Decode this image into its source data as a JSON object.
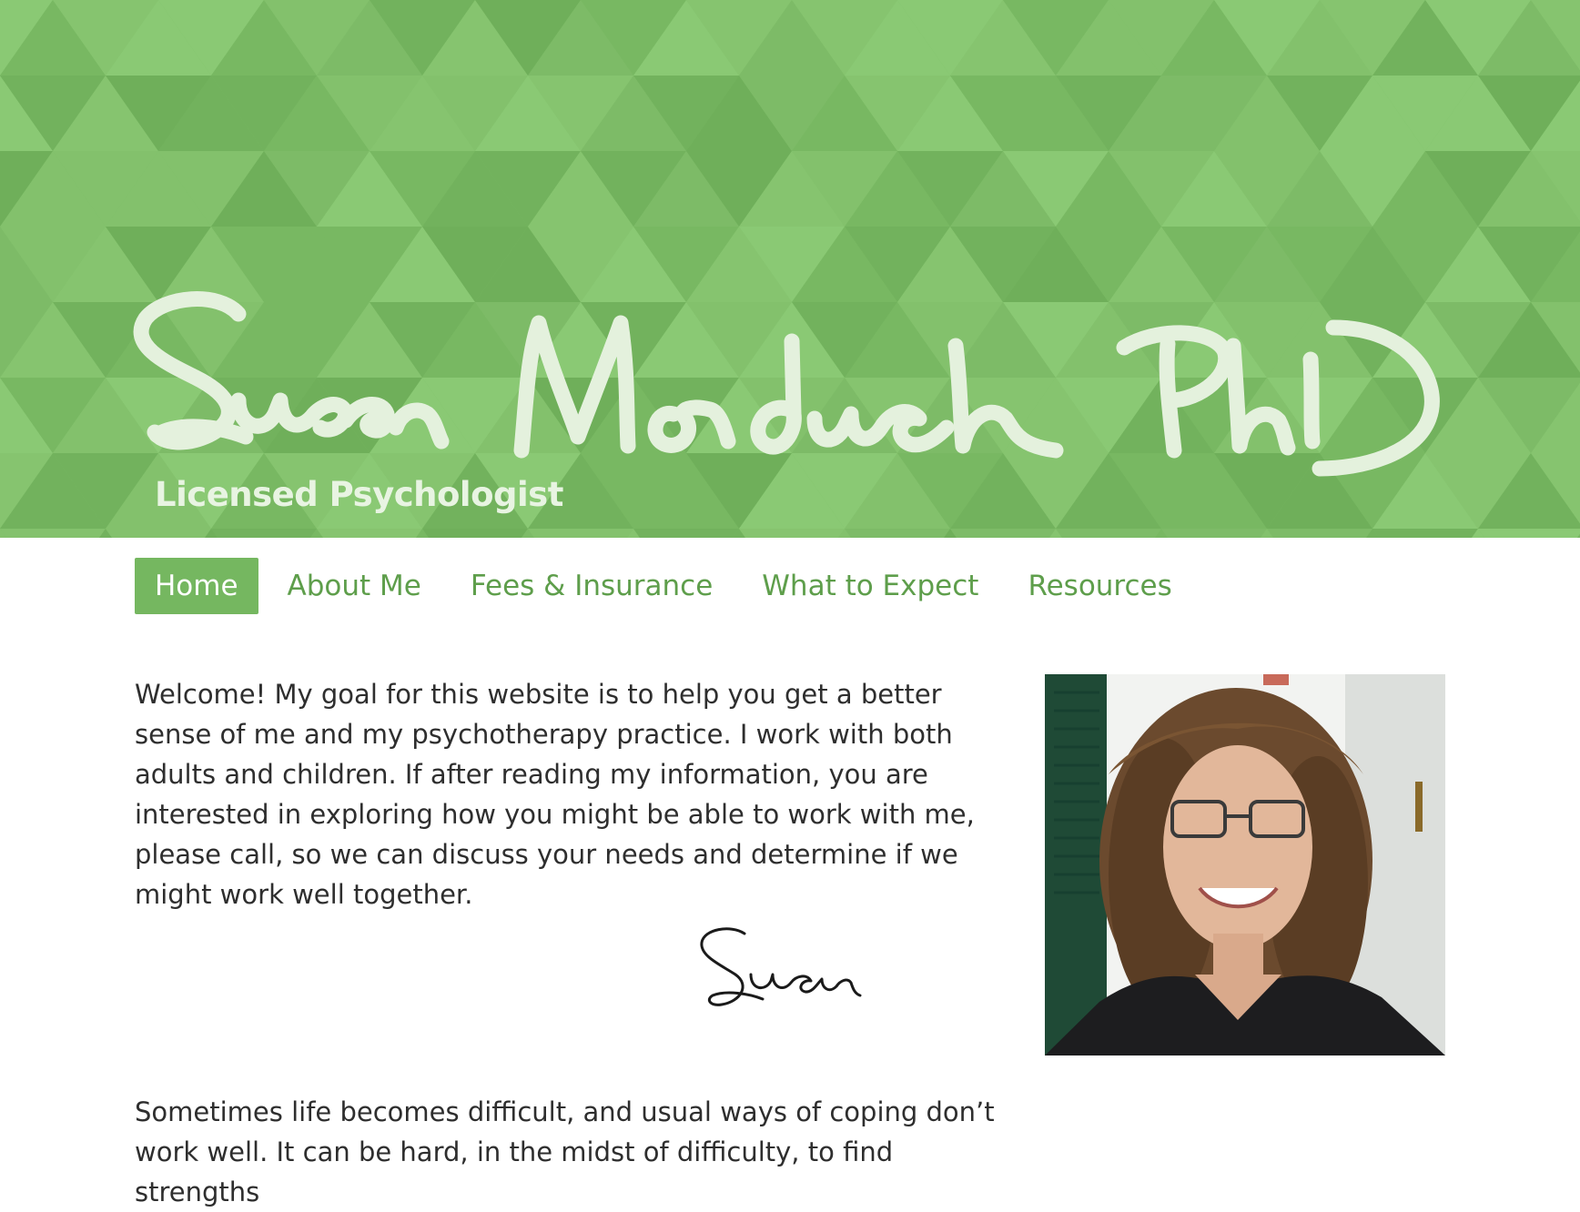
{
  "header": {
    "logo_text": "Susan Morduch PhD",
    "tagline": "Licensed Psychologist",
    "background_color": "#7fbe69",
    "script_color": "#e4f1dd"
  },
  "nav": {
    "items": [
      {
        "label": "Home",
        "active": true
      },
      {
        "label": "About Me",
        "active": false
      },
      {
        "label": "Fees & Insurance",
        "active": false
      },
      {
        "label": "What to Expect",
        "active": false
      },
      {
        "label": "Resources",
        "active": false
      }
    ],
    "link_color": "#5e9e4b",
    "active_bg": "#75b760"
  },
  "content": {
    "welcome": "Welcome! My goal for this website is to help you get a better sense of me and my psychotherapy practice. I work with both adults and children. If after reading my information, you are interested in exploring how you might be able to work with me, please call, so we can discuss your needs and determine if we might work well together.",
    "signature": "Susan",
    "intro": "Sometimes life becomes difficult, and usual ways of coping don’t work well. It can be hard, in the midst of difficulty, to find strengths"
  },
  "photo": {
    "subject": "smiling woman with curly hair and glasses"
  }
}
